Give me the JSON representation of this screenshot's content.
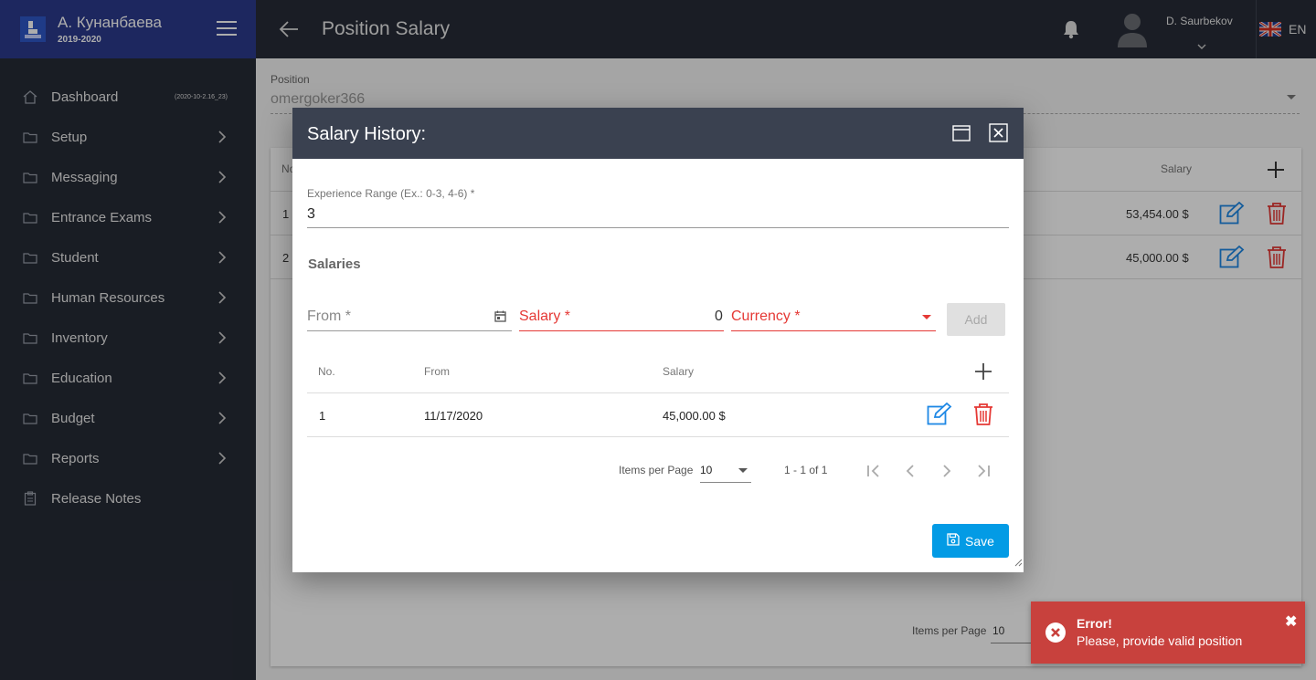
{
  "app": {
    "school_name": "А. Кунанбаева",
    "school_year": "2019-2020",
    "version": "(2020-10-2.16_23)"
  },
  "sidebar": {
    "items": [
      {
        "label": "Dashboard",
        "icon": "home-icon"
      },
      {
        "label": "Setup",
        "icon": "folder-icon"
      },
      {
        "label": "Messaging",
        "icon": "folder-icon"
      },
      {
        "label": "Entrance Exams",
        "icon": "folder-icon"
      },
      {
        "label": "Student",
        "icon": "folder-icon"
      },
      {
        "label": "Human Resources",
        "icon": "folder-icon"
      },
      {
        "label": "Inventory",
        "icon": "folder-icon"
      },
      {
        "label": "Education",
        "icon": "folder-icon"
      },
      {
        "label": "Budget",
        "icon": "folder-icon"
      },
      {
        "label": "Reports",
        "icon": "folder-icon"
      },
      {
        "label": "Release Notes",
        "icon": "clipboard-icon"
      }
    ]
  },
  "header": {
    "title": "Position Salary",
    "user_name": "D. Saurbekov",
    "language": "EN"
  },
  "page": {
    "position_label": "Position",
    "position_value": "omergoker366",
    "table": {
      "col_no": "No",
      "col_salary": "Salary",
      "rows": [
        {
          "no": "1",
          "salary": "53,454.00 $"
        },
        {
          "no": "2",
          "salary": "45,000.00 $"
        }
      ]
    },
    "items_per_page_label": "Items per Page",
    "items_per_page_value": "10"
  },
  "dialog": {
    "title": "Salary History:",
    "experience_label": "Experience Range (Ex.: 0-3, 4-6) *",
    "experience_value": "3",
    "salaries_heading": "Salaries",
    "from_placeholder": "From *",
    "salary_placeholder": "Salary *",
    "salary_value": "0",
    "currency_placeholder": "Currency *",
    "add_label": "Add",
    "table": {
      "col_no": "No.",
      "col_from": "From",
      "col_salary": "Salary",
      "rows": [
        {
          "no": "1",
          "from": "11/17/2020",
          "salary": "45,000.00 $"
        }
      ]
    },
    "paginator": {
      "items_per_page_label": "Items per Page",
      "items_per_page_value": "10",
      "range": "1 - 1 of 1"
    },
    "save_label": "Save"
  },
  "toast": {
    "title": "Error!",
    "message": "Please, provide valid position"
  },
  "colors": {
    "sidebar_bg": "#262b36",
    "brand_bg": "#2b3a8c",
    "dialog_header": "#3a4150",
    "primary": "#039be5",
    "error": "#e53935",
    "toast_bg": "#c8413d",
    "edit_icon": "#1e88e5",
    "delete_icon": "#e53935"
  }
}
